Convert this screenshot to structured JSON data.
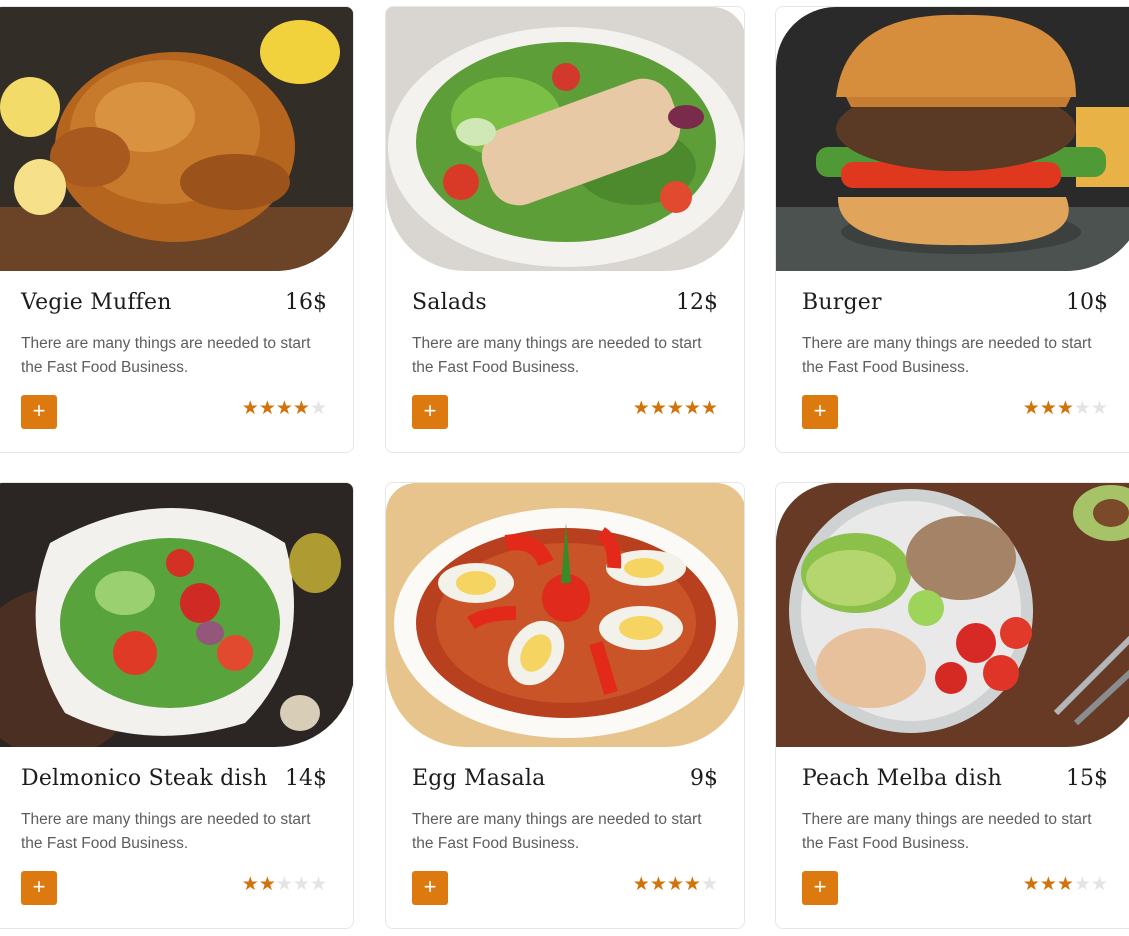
{
  "colors": {
    "accent": "#dc7a10",
    "star_on": "#d2720b",
    "star_off": "#e4e4e4"
  },
  "menu_items": [
    {
      "name": "Vegie Muffen",
      "price": "16$",
      "description": "There are many things are needed to start the Fast Food Business.",
      "rating": 4,
      "rating_max": 5,
      "image": "roast-chicken",
      "add_label": "+"
    },
    {
      "name": "Salads",
      "price": "12$",
      "description": "There are many things are needed to start the Fast Food Business.",
      "rating": 5,
      "rating_max": 5,
      "image": "chicken-salad",
      "add_label": "+"
    },
    {
      "name": "Burger",
      "price": "10$",
      "description": "There are many things are needed to start the Fast Food Business.",
      "rating": 3,
      "rating_max": 5,
      "image": "burger",
      "add_label": "+"
    },
    {
      "name": "Delmonico Steak dish",
      "price": "14$",
      "description": "There are many things are needed to start the Fast Food Business.",
      "rating": 2,
      "rating_max": 5,
      "image": "vegetable-salad-plate",
      "add_label": "+"
    },
    {
      "name": "Egg Masala",
      "price": "9$",
      "description": "There are many things are needed to start the Fast Food Business.",
      "rating": 4,
      "rating_max": 5,
      "image": "egg-masala-plate",
      "add_label": "+"
    },
    {
      "name": "Peach Melba dish",
      "price": "15$",
      "description": "There are many things are needed to start the Fast Food Business.",
      "rating": 3,
      "rating_max": 5,
      "image": "quinoa-bowl",
      "add_label": "+"
    }
  ]
}
